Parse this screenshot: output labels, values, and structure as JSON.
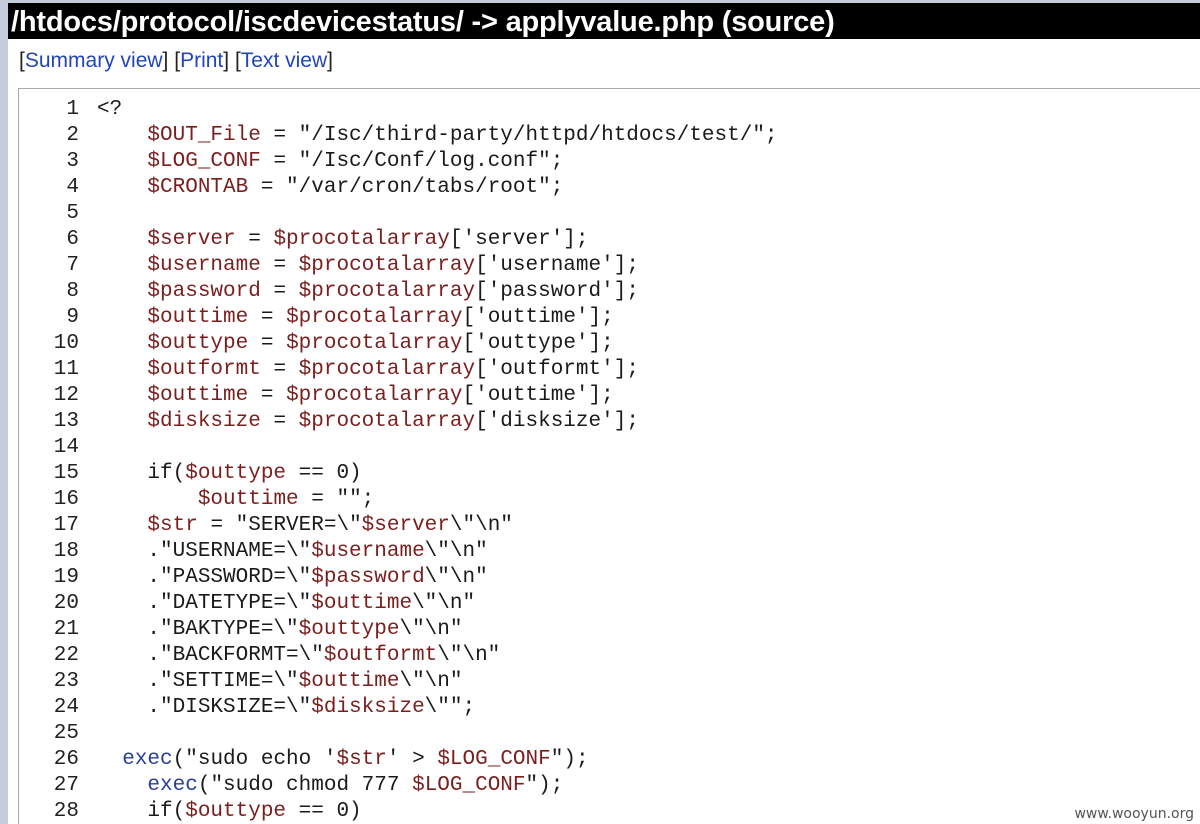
{
  "header": {
    "title": "/htdocs/protocol/iscdevicestatus/ -> applyvalue.php (source)"
  },
  "nav": {
    "open_bracket": "[",
    "close_bracket": "]",
    "summary_view": "Summary view",
    "print": "Print",
    "text_view": "Text view"
  },
  "code_lines": [
    {
      "num": "1",
      "tokens": [
        {
          "t": "txt",
          "v": "<?"
        }
      ]
    },
    {
      "num": "2",
      "tokens": [
        {
          "t": "txt",
          "v": "    "
        },
        {
          "t": "var",
          "v": "$OUT_File"
        },
        {
          "t": "txt",
          "v": " = \"/Isc/third-party/httpd/htdocs/test/\";"
        }
      ]
    },
    {
      "num": "3",
      "tokens": [
        {
          "t": "txt",
          "v": "    "
        },
        {
          "t": "var",
          "v": "$LOG_CONF"
        },
        {
          "t": "txt",
          "v": " = \"/Isc/Conf/log.conf\";"
        }
      ]
    },
    {
      "num": "4",
      "tokens": [
        {
          "t": "txt",
          "v": "    "
        },
        {
          "t": "var",
          "v": "$CRONTAB"
        },
        {
          "t": "txt",
          "v": " = \"/var/cron/tabs/root\";"
        }
      ]
    },
    {
      "num": "5",
      "tokens": []
    },
    {
      "num": "6",
      "tokens": [
        {
          "t": "txt",
          "v": "    "
        },
        {
          "t": "var",
          "v": "$server"
        },
        {
          "t": "txt",
          "v": " = "
        },
        {
          "t": "var",
          "v": "$procotalarray"
        },
        {
          "t": "txt",
          "v": "['server'];"
        }
      ]
    },
    {
      "num": "7",
      "tokens": [
        {
          "t": "txt",
          "v": "    "
        },
        {
          "t": "var",
          "v": "$username"
        },
        {
          "t": "txt",
          "v": " = "
        },
        {
          "t": "var",
          "v": "$procotalarray"
        },
        {
          "t": "txt",
          "v": "['username'];"
        }
      ]
    },
    {
      "num": "8",
      "tokens": [
        {
          "t": "txt",
          "v": "    "
        },
        {
          "t": "var",
          "v": "$password"
        },
        {
          "t": "txt",
          "v": " = "
        },
        {
          "t": "var",
          "v": "$procotalarray"
        },
        {
          "t": "txt",
          "v": "['password'];"
        }
      ]
    },
    {
      "num": "9",
      "tokens": [
        {
          "t": "txt",
          "v": "    "
        },
        {
          "t": "var",
          "v": "$outtime"
        },
        {
          "t": "txt",
          "v": " = "
        },
        {
          "t": "var",
          "v": "$procotalarray"
        },
        {
          "t": "txt",
          "v": "['outtime'];"
        }
      ]
    },
    {
      "num": "10",
      "tokens": [
        {
          "t": "txt",
          "v": "    "
        },
        {
          "t": "var",
          "v": "$outtype"
        },
        {
          "t": "txt",
          "v": " = "
        },
        {
          "t": "var",
          "v": "$procotalarray"
        },
        {
          "t": "txt",
          "v": "['outtype'];"
        }
      ]
    },
    {
      "num": "11",
      "tokens": [
        {
          "t": "txt",
          "v": "    "
        },
        {
          "t": "var",
          "v": "$outformt"
        },
        {
          "t": "txt",
          "v": " = "
        },
        {
          "t": "var",
          "v": "$procotalarray"
        },
        {
          "t": "txt",
          "v": "['outformt'];"
        }
      ]
    },
    {
      "num": "12",
      "tokens": [
        {
          "t": "txt",
          "v": "    "
        },
        {
          "t": "var",
          "v": "$outtime"
        },
        {
          "t": "txt",
          "v": " = "
        },
        {
          "t": "var",
          "v": "$procotalarray"
        },
        {
          "t": "txt",
          "v": "['outtime'];"
        }
      ]
    },
    {
      "num": "13",
      "tokens": [
        {
          "t": "txt",
          "v": "    "
        },
        {
          "t": "var",
          "v": "$disksize"
        },
        {
          "t": "txt",
          "v": " = "
        },
        {
          "t": "var",
          "v": "$procotalarray"
        },
        {
          "t": "txt",
          "v": "['disksize'];"
        }
      ]
    },
    {
      "num": "14",
      "tokens": []
    },
    {
      "num": "15",
      "tokens": [
        {
          "t": "txt",
          "v": "    if("
        },
        {
          "t": "var",
          "v": "$outtype"
        },
        {
          "t": "txt",
          "v": " == 0)"
        }
      ]
    },
    {
      "num": "16",
      "tokens": [
        {
          "t": "txt",
          "v": "        "
        },
        {
          "t": "var",
          "v": "$outtime"
        },
        {
          "t": "txt",
          "v": " = \"\";"
        }
      ]
    },
    {
      "num": "17",
      "tokens": [
        {
          "t": "txt",
          "v": "    "
        },
        {
          "t": "var",
          "v": "$str"
        },
        {
          "t": "txt",
          "v": " = \"SERVER=\\\""
        },
        {
          "t": "var",
          "v": "$server"
        },
        {
          "t": "txt",
          "v": "\\\"\\n\""
        }
      ]
    },
    {
      "num": "18",
      "tokens": [
        {
          "t": "txt",
          "v": "    .\"USERNAME=\\\""
        },
        {
          "t": "var",
          "v": "$username"
        },
        {
          "t": "txt",
          "v": "\\\"\\n\""
        }
      ]
    },
    {
      "num": "19",
      "tokens": [
        {
          "t": "txt",
          "v": "    .\"PASSWORD=\\\""
        },
        {
          "t": "var",
          "v": "$password"
        },
        {
          "t": "txt",
          "v": "\\\"\\n\""
        }
      ]
    },
    {
      "num": "20",
      "tokens": [
        {
          "t": "txt",
          "v": "    .\"DATETYPE=\\\""
        },
        {
          "t": "var",
          "v": "$outtime"
        },
        {
          "t": "txt",
          "v": "\\\"\\n\""
        }
      ]
    },
    {
      "num": "21",
      "tokens": [
        {
          "t": "txt",
          "v": "    .\"BAKTYPE=\\\""
        },
        {
          "t": "var",
          "v": "$outtype"
        },
        {
          "t": "txt",
          "v": "\\\"\\n\""
        }
      ]
    },
    {
      "num": "22",
      "tokens": [
        {
          "t": "txt",
          "v": "    .\"BACKFORMT=\\\""
        },
        {
          "t": "var",
          "v": "$outformt"
        },
        {
          "t": "txt",
          "v": "\\\"\\n\""
        }
      ]
    },
    {
      "num": "23",
      "tokens": [
        {
          "t": "txt",
          "v": "    .\"SETTIME=\\\""
        },
        {
          "t": "var",
          "v": "$outtime"
        },
        {
          "t": "txt",
          "v": "\\\"\\n\""
        }
      ]
    },
    {
      "num": "24",
      "tokens": [
        {
          "t": "txt",
          "v": "    .\"DISKSIZE=\\\""
        },
        {
          "t": "var",
          "v": "$disksize"
        },
        {
          "t": "txt",
          "v": "\\\"\";"
        }
      ]
    },
    {
      "num": "25",
      "tokens": []
    },
    {
      "num": "26",
      "tokens": [
        {
          "t": "txt",
          "v": "  "
        },
        {
          "t": "fn",
          "v": "exec"
        },
        {
          "t": "txt",
          "v": "(\"sudo echo '"
        },
        {
          "t": "var",
          "v": "$str"
        },
        {
          "t": "txt",
          "v": "' > "
        },
        {
          "t": "var",
          "v": "$LOG_CONF"
        },
        {
          "t": "txt",
          "v": "\");"
        }
      ]
    },
    {
      "num": "27",
      "tokens": [
        {
          "t": "txt",
          "v": "    "
        },
        {
          "t": "fn",
          "v": "exec"
        },
        {
          "t": "txt",
          "v": "(\"sudo chmod 777 "
        },
        {
          "t": "var",
          "v": "$LOG_CONF"
        },
        {
          "t": "txt",
          "v": "\");"
        }
      ]
    },
    {
      "num": "28",
      "tokens": [
        {
          "t": "txt",
          "v": "    if("
        },
        {
          "t": "var",
          "v": "$outtype"
        },
        {
          "t": "txt",
          "v": " == 0)"
        }
      ]
    }
  ],
  "watermark": "www.wooyun.org",
  "colors": {
    "variable": "#7a1e1e",
    "function": "#2a3d99",
    "link": "#2244bb",
    "title_bg": "#000000",
    "frame_bg": "#c4ccdc"
  }
}
